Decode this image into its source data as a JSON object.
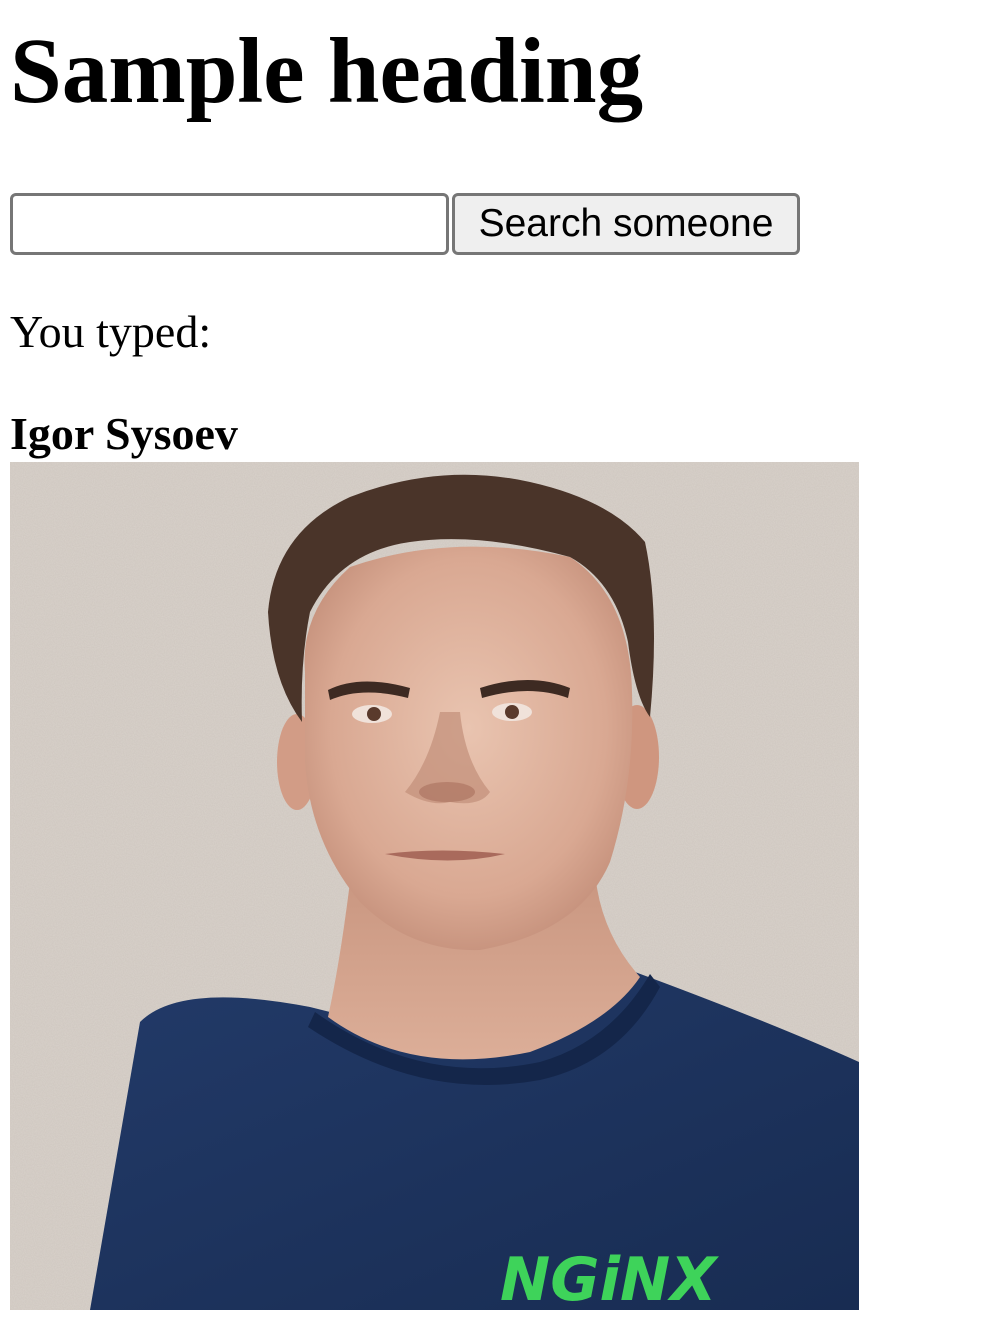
{
  "page": {
    "heading": "Sample heading"
  },
  "search": {
    "input_value": "",
    "button_label": "Search someone"
  },
  "typed_label": "You typed:",
  "result": {
    "name": "Igor Sysoev",
    "shirt_logo_text": "NGiNX"
  },
  "colors": {
    "input_border": "#767676",
    "button_bg": "#efefef",
    "shirt": "#1e3560",
    "logo": "#3ed35a",
    "background_wall": "#d8d1ca"
  }
}
